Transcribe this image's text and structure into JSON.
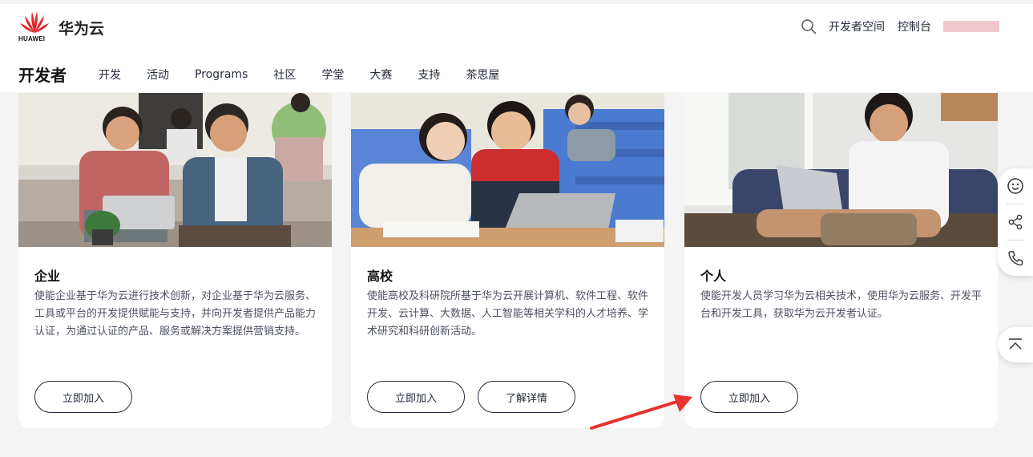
{
  "brand": {
    "logo_text": "HUAWEI",
    "name": "华为云",
    "logo_color": "#e0242a"
  },
  "top_bar": {
    "links": [
      "开发者空间",
      "控制台"
    ],
    "user_placeholder_color": "#efc7cd"
  },
  "nav": {
    "title": "开发者",
    "items": [
      "开发",
      "活动",
      "Programs",
      "社区",
      "学堂",
      "大赛",
      "支持",
      "茶思屋"
    ]
  },
  "cards": [
    {
      "title": "企业",
      "description": "使能企业基于华为云进行技术创新，对企业基于华为云服务、工具或平台的开发提供赋能与支持，并向开发者提供产品能力认证，为通过认证的产品、服务或解决方案提供营销支持。",
      "buttons": [
        "立即加入"
      ]
    },
    {
      "title": "高校",
      "description": "使能高校及科研院所基于华为云开展计算机、软件工程、软件开发、云计算、大数据、人工智能等相关学科的人才培养、学术研究和科研创新活动。",
      "buttons": [
        "立即加入",
        "了解详情"
      ]
    },
    {
      "title": "个人",
      "description": "使能开发人员学习华为云相关技术，使用华为云服务、开发平台和开发工具，获取华为云开发者认证。",
      "buttons": [
        "立即加入"
      ]
    }
  ],
  "side_tools": [
    "smile-icon",
    "share-icon",
    "phone-icon"
  ],
  "back_to_top_icon": "back-to-top-icon",
  "annotation_color": "#e8322e"
}
